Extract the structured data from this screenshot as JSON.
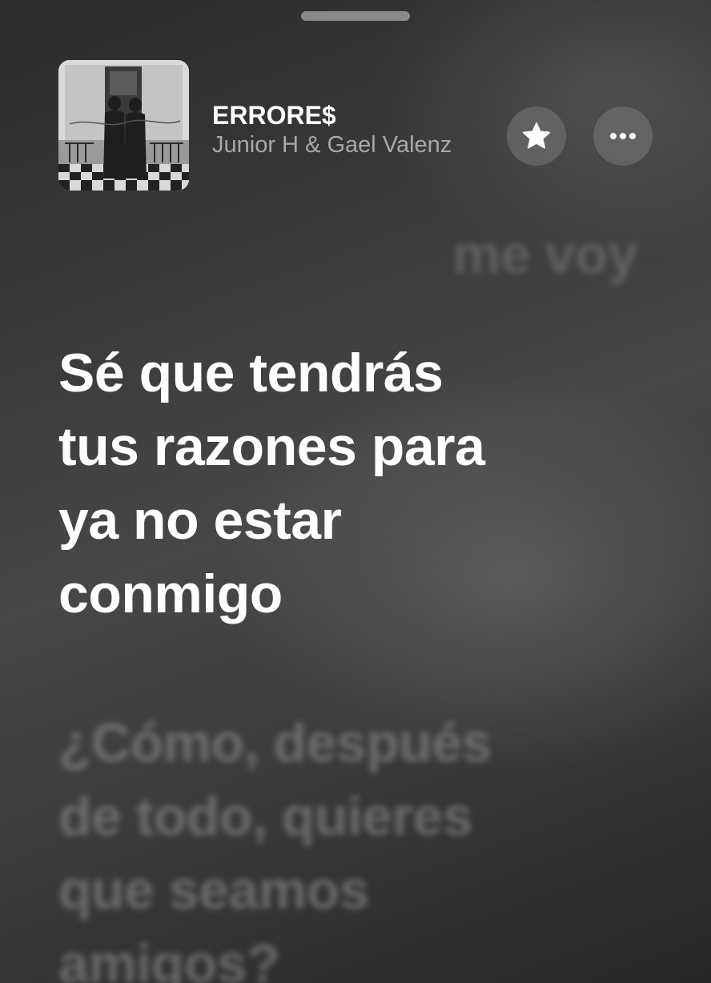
{
  "track": {
    "title": "ERRORE$",
    "artist": "Junior H & Gael Valenz"
  },
  "icons": {
    "favorite": "star-icon",
    "more": "ellipsis-icon"
  },
  "lyrics": {
    "previous": "me voy",
    "current": [
      "Sé que tendrás",
      "tus razones para",
      "ya no estar",
      "conmigo"
    ],
    "next": [
      "¿Cómo, después",
      "de todo, quieres",
      "que seamos",
      "amigos?"
    ]
  },
  "colors": {
    "background": "#3a3a3a",
    "active_lyric": "#ffffff",
    "inactive_lyric": "#8c8c8c",
    "artist_text": "#a8a8a8"
  }
}
